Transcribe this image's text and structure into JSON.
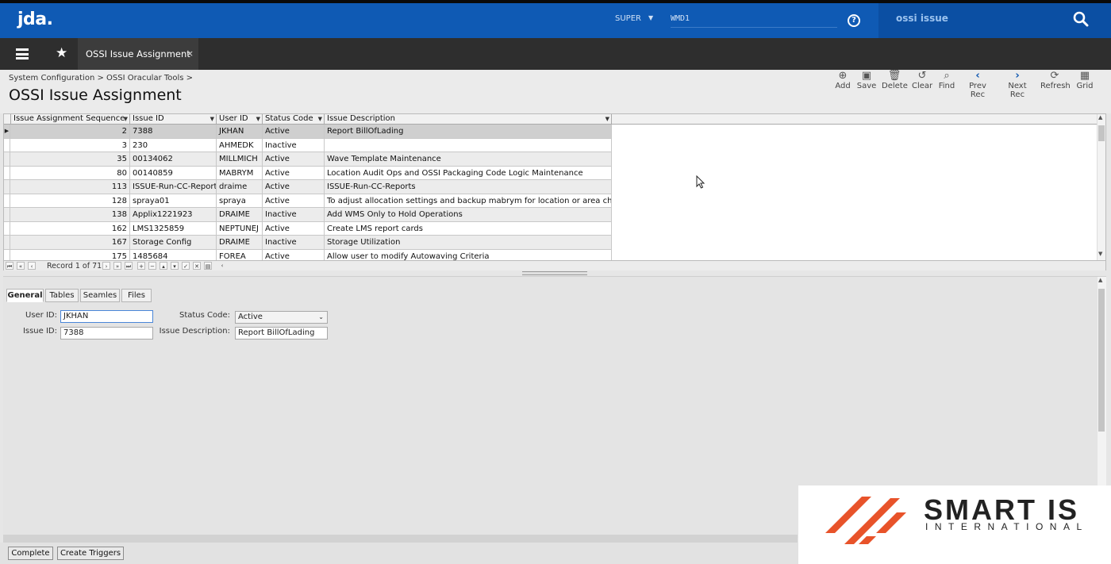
{
  "app": {
    "logo": "jda.",
    "user": "SUPER",
    "warehouse": "WMD1",
    "search_text": "ossi issue"
  },
  "tab": {
    "label": "OSSI Issue Assignment",
    "close": "×"
  },
  "breadcrumb": "System Configuration > OSSI Oracular Tools >",
  "page_title": "OSSI Issue Assignment",
  "toolbar": [
    {
      "label": "Add",
      "icon": "add-icon"
    },
    {
      "label": "Save",
      "icon": "save-icon"
    },
    {
      "label": "Delete",
      "icon": "delete-icon"
    },
    {
      "label": "Clear",
      "icon": "clear-icon"
    },
    {
      "label": "Find",
      "icon": "find-icon"
    },
    {
      "label": "Prev Rec",
      "icon": "prev-icon"
    },
    {
      "label": "Next Rec",
      "icon": "next-icon"
    },
    {
      "label": "Refresh",
      "icon": "refresh-icon"
    },
    {
      "label": "Grid",
      "icon": "grid-icon"
    }
  ],
  "grid": {
    "columns": [
      "Issue Assignment Sequence",
      "Issue ID",
      "User ID",
      "Status Code",
      "Issue Description"
    ],
    "rows": [
      [
        "2",
        "7388",
        "JKHAN",
        "Active",
        "Report BillOfLading"
      ],
      [
        "3",
        "230",
        "AHMEDK",
        "Inactive",
        ""
      ],
      [
        "35",
        "00134062",
        "MILLMICH",
        "Active",
        "Wave Template Maintenance"
      ],
      [
        "80",
        "00140859",
        "MABRYM",
        "Active",
        "Location Audit Ops and OSSI Packaging Code Logic Maintenance"
      ],
      [
        "113",
        "ISSUE-Run-CC-Reports",
        "draime",
        "Active",
        "ISSUE-Run-CC-Reports"
      ],
      [
        "128",
        "spraya01",
        "spraya",
        "Active",
        "To adjust allocation settings and backup mabrym for location or area changes"
      ],
      [
        "138",
        "Applix1221923",
        "DRAIME",
        "Inactive",
        "Add WMS Only to Hold Operations"
      ],
      [
        "162",
        "LMS1325859",
        "NEPTUNEJ",
        "Active",
        "Create LMS report cards"
      ],
      [
        "167",
        "Storage Config",
        "DRAIME",
        "Inactive",
        "Storage Utilization"
      ],
      [
        "175",
        "1485684",
        "FOREA",
        "Active",
        "Allow user to modify Autowaving Criteria"
      ]
    ],
    "record_text": "Record 1 of 71"
  },
  "detail": {
    "tabs": [
      "General",
      "Tables",
      "Seamles",
      "Files"
    ],
    "user_id_label": "User ID:",
    "user_id_value": "JKHAN",
    "issue_id_label": "Issue ID:",
    "issue_id_value": "7388",
    "status_label": "Status Code:",
    "status_value": "Active",
    "desc_label": "Issue Description:",
    "desc_value": "Report BillOfLading"
  },
  "buttons": {
    "complete": "Complete",
    "create_triggers": "Create Triggers"
  },
  "brand": {
    "name": "SMART IS",
    "sub": "INTERNATIONAL"
  },
  "colors": {
    "top_bar": "#0f5ab4",
    "tab_bar": "#2e2e2e",
    "brand_orange": "#e8532a"
  }
}
